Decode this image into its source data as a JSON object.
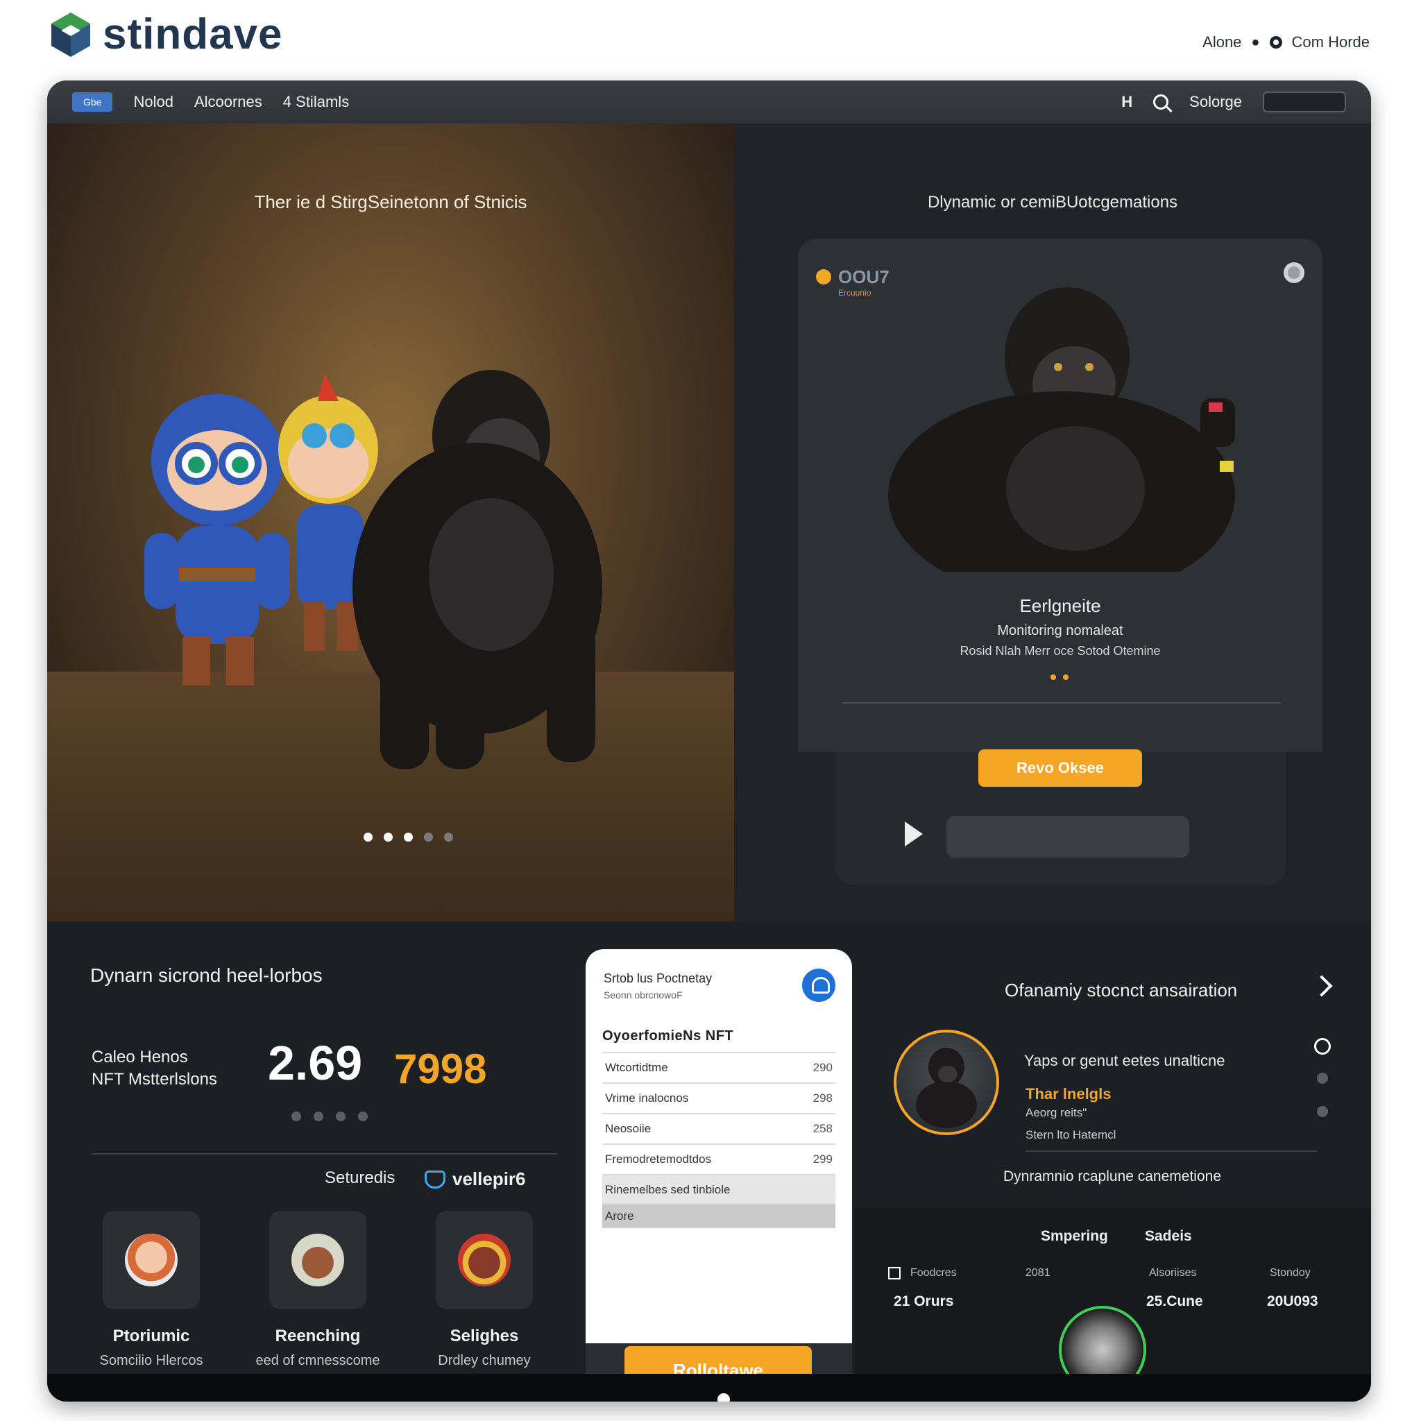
{
  "brand": {
    "name": "stindave"
  },
  "top_links": {
    "item1": "Alone",
    "item2": "Com Horde"
  },
  "nav": {
    "badge": "Gbe",
    "items": [
      "Nolod",
      "Alcoornes",
      "4 Stilamls"
    ],
    "right_letter": "H",
    "search_label": "Solorge"
  },
  "hero_left": {
    "title": "Ther ie d StirgSeinetonn of Stnicis"
  },
  "hero_right": {
    "title": "Dlynamic or cemiBUotcgemations",
    "card": {
      "code": "OOU7",
      "code_sub": "Ercuunio",
      "name": "Eerlgneite",
      "line1": "Monitoring nomaleat",
      "line2": "Rosid Nlah Merr oce Sotod Otemine"
    },
    "button": "Revo Oksee"
  },
  "bottom_left": {
    "title": "Dynarn sicrond heel-lorbos",
    "stat_label_line1": "Caleo Henos",
    "stat_label_line2": "NFT Mstterlslons",
    "stat_big": "2.69",
    "stat_orange": "7998",
    "col_head": "Seturedis",
    "brand_mini": "vellepir6",
    "characters": [
      {
        "name": "Ptoriumic",
        "sub": "Somcilio Hlercos"
      },
      {
        "name": "Reenching",
        "sub": "eed of cmnesscome"
      },
      {
        "name": "Selighes",
        "sub": "Drdley chumey"
      }
    ]
  },
  "panel": {
    "title": "Srtob lus Poctnetay",
    "subtitle": "Seonn obrcnowoF",
    "table_head": "OyoerfomieNs NFT",
    "rows": [
      {
        "label": "Wtcortidtme",
        "value": "290"
      },
      {
        "label": "Vrime inalocnos",
        "value": "298"
      },
      {
        "label": "Neosoiie",
        "value": "258"
      },
      {
        "label": "Fremodretemodtdos",
        "value": "299"
      },
      {
        "label": "Rinemelbes sed tinbiole",
        "value": ""
      },
      {
        "label": "Arore",
        "value": ""
      }
    ],
    "button": "Rolloltawe"
  },
  "bottom_right": {
    "title": "Ofanamiy stocnct ansairation",
    "line1": "Yaps or genut eetes unalticne",
    "line2": "Thar lnelgls",
    "line3": "Aeorg reits\"",
    "line4": "Stern lto Hatemcl",
    "sub": "Dynramnio rcaplune canemetione",
    "stats": {
      "head1": "Smpering",
      "head2": "Sadeis",
      "labels": [
        "Foodcres",
        "2081",
        "Alsoriises",
        "Stondoy"
      ],
      "values": [
        "21 Orurs",
        "25.Cune",
        "20U093"
      ]
    }
  },
  "colors": {
    "accent": "#f6a525",
    "panel_icon": "#1f6fd6",
    "dark_bg": "#1c1f23"
  }
}
